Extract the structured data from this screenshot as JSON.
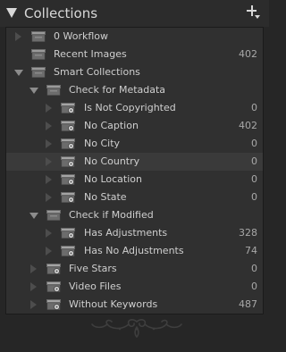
{
  "header": {
    "title": "Collections"
  },
  "rows": [
    {
      "label": "0 Workflow",
      "count": "",
      "icon": "collection-set-icon",
      "disc": "closed"
    },
    {
      "label": "Recent Images",
      "count": "402",
      "icon": "collection-icon",
      "disc": "none"
    },
    {
      "label": "Smart Collections",
      "count": "",
      "icon": "collection-set-icon",
      "disc": "open"
    },
    {
      "label": "Check for Metadata",
      "count": "",
      "icon": "collection-set-icon",
      "disc": "open"
    },
    {
      "label": "Is Not Copyrighted",
      "count": "0",
      "icon": "smart-collection-icon",
      "disc": "none"
    },
    {
      "label": "No Caption",
      "count": "402",
      "icon": "smart-collection-icon",
      "disc": "none"
    },
    {
      "label": "No City",
      "count": "0",
      "icon": "smart-collection-icon",
      "disc": "none"
    },
    {
      "label": "No Country",
      "count": "0",
      "icon": "smart-collection-icon",
      "disc": "none"
    },
    {
      "label": "No Location",
      "count": "0",
      "icon": "smart-collection-icon",
      "disc": "none"
    },
    {
      "label": "No State",
      "count": "0",
      "icon": "smart-collection-icon",
      "disc": "none"
    },
    {
      "label": "Check if Modified",
      "count": "",
      "icon": "collection-set-icon",
      "disc": "open"
    },
    {
      "label": "Has Adjustments",
      "count": "328",
      "icon": "smart-collection-icon",
      "disc": "none"
    },
    {
      "label": "Has No Adjustments",
      "count": "74",
      "icon": "smart-collection-icon",
      "disc": "none"
    },
    {
      "label": "Five Stars",
      "count": "0",
      "icon": "smart-collection-icon",
      "disc": "none"
    },
    {
      "label": "Video Files",
      "count": "0",
      "icon": "smart-collection-icon",
      "disc": "none"
    },
    {
      "label": "Without Keywords",
      "count": "487",
      "icon": "smart-collection-icon",
      "disc": "none"
    }
  ],
  "selected_row": "No Country"
}
